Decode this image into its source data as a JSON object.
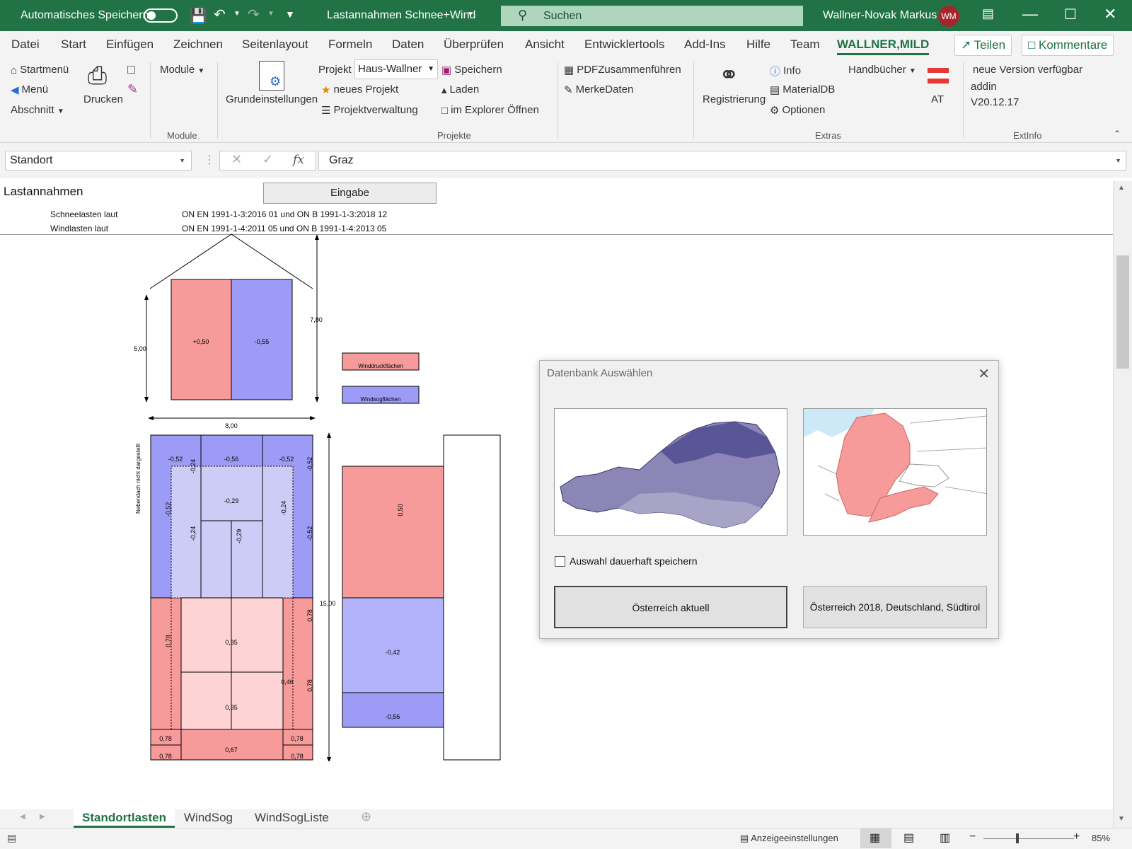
{
  "titlebar": {
    "autosave_label": "Automatisches Speichern",
    "doc_title": "Lastannahmen Schnee+Wind",
    "search_placeholder": "Suchen",
    "user_name": "Wallner-Novak Markus",
    "user_initials": "WM"
  },
  "menu": {
    "tabs": [
      "Datei",
      "Start",
      "Einfügen",
      "Zeichnen",
      "Seitenlayout",
      "Formeln",
      "Daten",
      "Überprüfen",
      "Ansicht",
      "Entwicklertools",
      "Add-Ins",
      "Hilfe",
      "Team",
      "WALLNER,MILD"
    ],
    "share": "Teilen",
    "comments": "Kommentare"
  },
  "ribbon": {
    "nav": {
      "startmenu": "Startmenü",
      "menu": "Menü",
      "section": "Abschnitt"
    },
    "print": "Drucken",
    "modules": {
      "dropdown": "Module",
      "group": "Module"
    },
    "settings": "Grundeinstellungen",
    "project": {
      "label": "Projekt",
      "value": "Haus-Wallner",
      "new": "neues Projekt",
      "manage": "Projektverwaltung",
      "save": "Speichern",
      "load": "Laden",
      "explorer": "im Explorer Öffnen",
      "group": "Projekte"
    },
    "pdf": "PDFZusammenführen",
    "notes": "MerkeDaten",
    "extras": {
      "register": "Registrierung",
      "info": "Info",
      "materialdb": "MaterialDB",
      "options": "Optionen",
      "manuals": "Handbücher",
      "group": "Extras"
    },
    "country": "AT",
    "extinfo": {
      "line1": "neue Version verfügbar",
      "line2": "addin",
      "line3": "V20.12.17",
      "group": "ExtInfo"
    }
  },
  "formula": {
    "name_box": "Standort",
    "value": "Graz"
  },
  "sheet": {
    "title": "Lastannahmen",
    "input_button": "Eingabe",
    "snow_label": "Schneelasten laut",
    "snow_norm": "ON EN 1991-1-3:2016 01 und ON B 1991-1-3:2018 12",
    "wind_label": "Windlasten laut",
    "wind_norm": "ON EN 1991-1-4:2011 05 und ON B 1991-1-4:2013 05",
    "elevation": {
      "height_left": "5,00",
      "height_right": "7,80",
      "left_value": "+0,50",
      "right_value": "-0,55"
    },
    "legend": {
      "pressure": "Winddruckflächen",
      "suction": "Windsogflächen"
    },
    "plan": {
      "width": "8,00",
      "length": "15,00",
      "side_note": "Nebendach nicht dargestellt",
      "labels": {
        "top_l": "-0,52",
        "top_m": "-0,56",
        "top_r": "-0,52",
        "side_l": "-0,52",
        "side_r": "-0,52",
        "in_a": "-0,24",
        "in_b": "-0,29",
        "in_c": "-0,24",
        "in_d": "-0,24",
        "in_e": "-0,29",
        "in_f": "-0,52",
        "low_l": "0,78",
        "low_r": "0,78",
        "low_r2": "0,78",
        "mid_1": "0,35",
        "mid_2": "0,35",
        "mid_3": "0,46",
        "bot_l1": "0,78",
        "bot_r1": "0,78",
        "bot_m": "0,67",
        "bot_l2": "0,78",
        "bot_r2": "0,78"
      }
    },
    "section": {
      "top": "0,50",
      "mid": "-0,42",
      "bot": "-0,56"
    }
  },
  "dialog": {
    "title": "Datenbank Auswählen",
    "checkbox_label": "Auswahl dauerhaft speichern",
    "btn_austria": "Österreich aktuell",
    "btn_multi": "Österreich 2018, Deutschland, Südtirol"
  },
  "sheet_tabs": [
    "Standortlasten",
    "WindSog",
    "WindSogListe"
  ],
  "status": {
    "display_settings": "Anzeigeeinstellungen",
    "zoom": "85%"
  },
  "colors": {
    "excel_green": "#217346",
    "pressure": "#f79a9a",
    "suction": "#9c9cf7"
  }
}
